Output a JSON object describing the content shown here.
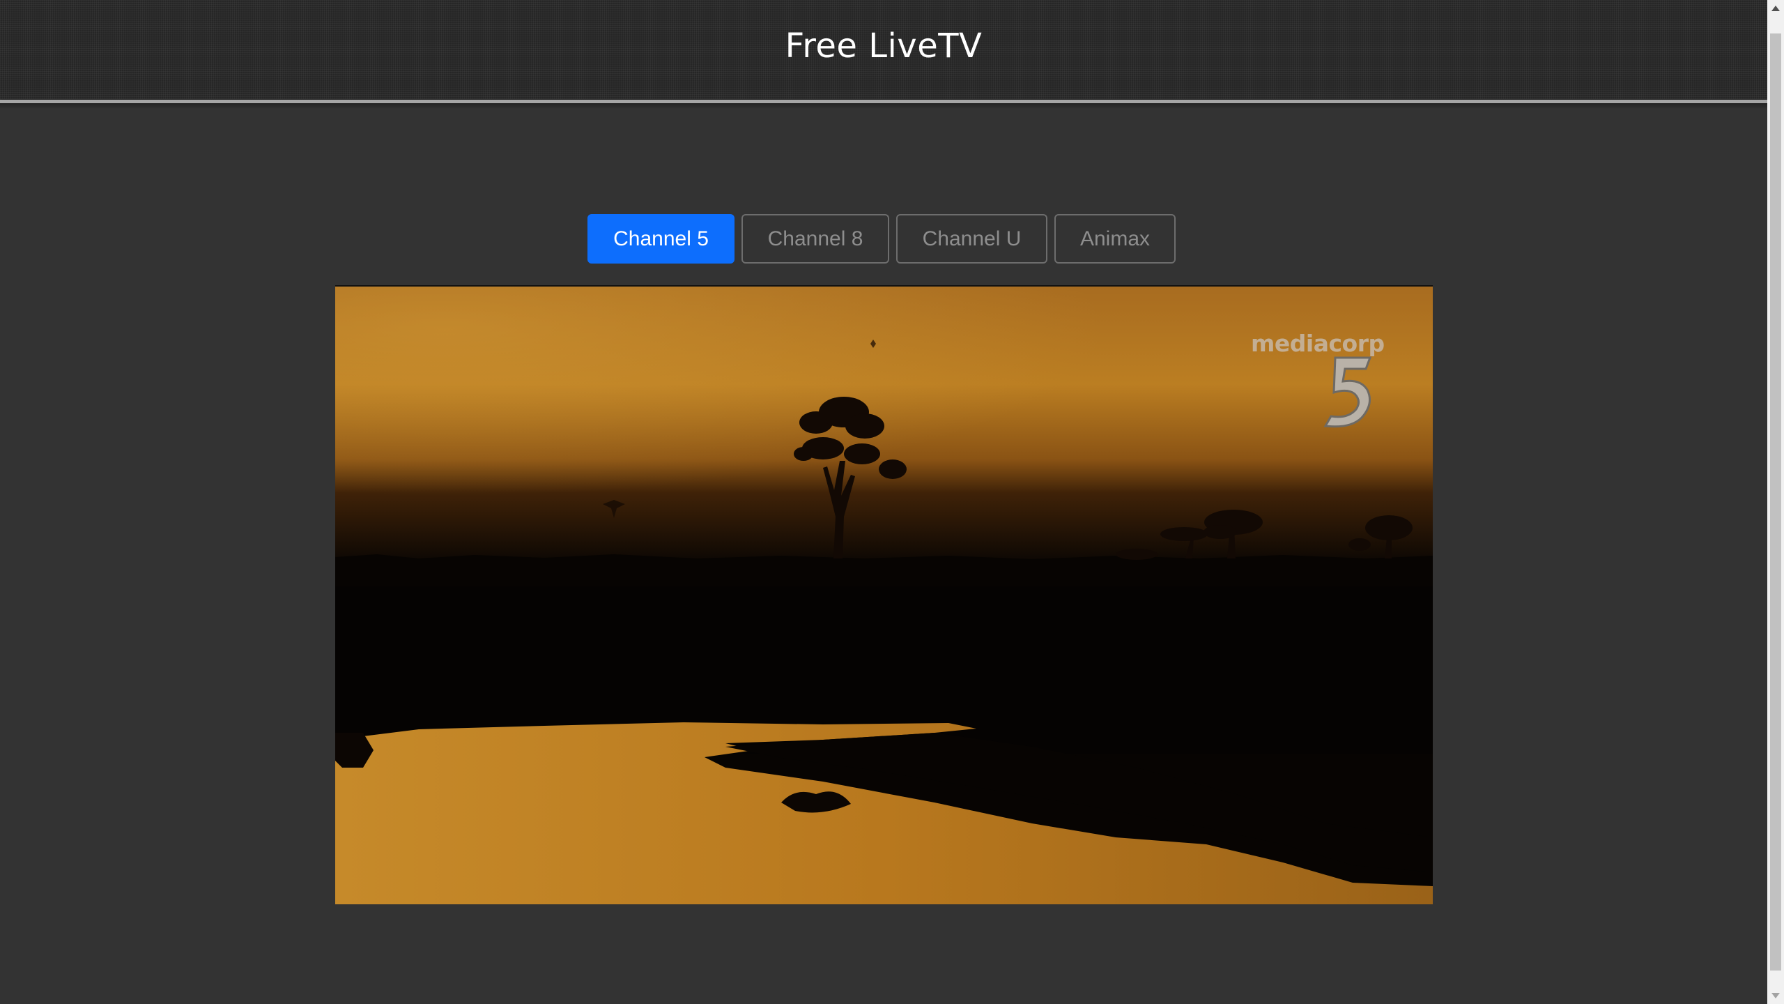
{
  "header": {
    "title": "Free LiveTV"
  },
  "channels": {
    "items": [
      {
        "label": "Channel 5",
        "active": true
      },
      {
        "label": "Channel 8",
        "active": false
      },
      {
        "label": "Channel U",
        "active": false
      },
      {
        "label": "Animax",
        "active": false
      }
    ]
  },
  "player": {
    "watermark_text": "mediacorp",
    "watermark_number": "5"
  },
  "colors": {
    "page_background": "#333333",
    "active_button": "#0d6efd",
    "inactive_button_text": "#8e8e8e"
  },
  "icons": {
    "scroll_up": "triangle-up-icon",
    "scroll_down": "triangle-down-icon"
  }
}
